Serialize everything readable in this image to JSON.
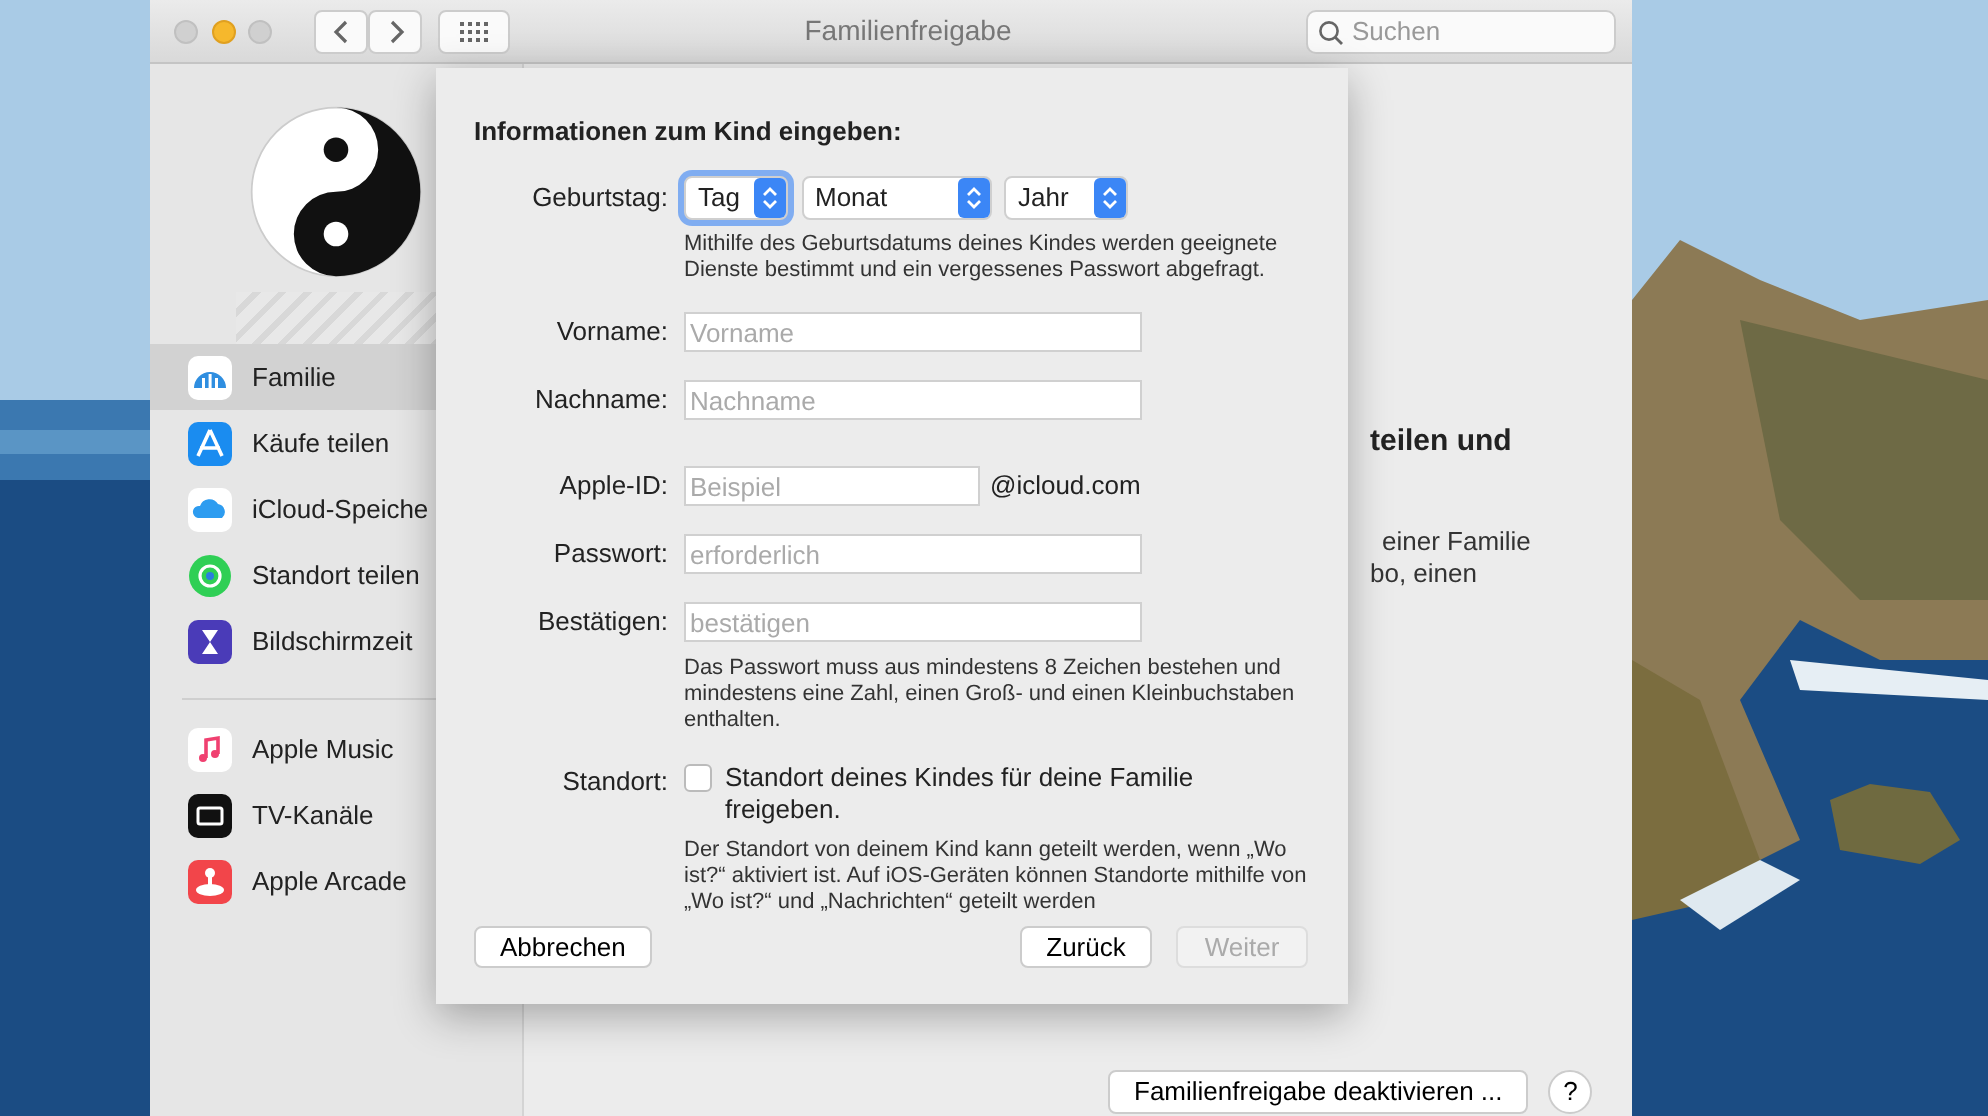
{
  "window": {
    "title": "Familienfreigabe",
    "search": {
      "placeholder": "Suchen"
    }
  },
  "sidebar": {
    "sections": [
      [
        {
          "label": "Familie",
          "selected": true
        },
        {
          "label": "Käufe teilen",
          "selected": false
        },
        {
          "label": "iCloud-Speiche",
          "selected": false
        },
        {
          "label": "Standort teilen",
          "selected": false
        },
        {
          "label": "Bildschirmzeit",
          "selected": false
        }
      ],
      [
        {
          "label": "Apple Music",
          "selected": false
        },
        {
          "label": "TV-Kanäle",
          "selected": false
        },
        {
          "label": "Apple Arcade",
          "selected": false
        }
      ]
    ]
  },
  "main": {
    "heading": "teilen und",
    "text_lines": [
      "einer Familie",
      "bo, einen"
    ],
    "deactivate_button": "Familienfreigabe deaktivieren ...",
    "help_button": "?"
  },
  "dialog": {
    "heading": "Informationen zum Kind eingeben:",
    "birthday": {
      "label": "Geburtstag:",
      "popups": [
        {
          "value": "Tag",
          "focused": true
        },
        {
          "value": "Monat",
          "focused": false
        },
        {
          "value": "Jahr",
          "focused": false
        }
      ]
    },
    "birthday_hint": "Mithilfe des Geburtsdatums deines Kindes werden geeignete Dienste bestimmt und ein vergessenes Passwort abgefragt.",
    "fields": [
      {
        "label": "Vorname:",
        "placeholder": "Vorname"
      },
      {
        "label": "Nachname:",
        "placeholder": "Nachname"
      },
      {
        "label": "Apple-ID:",
        "placeholder": "Beispiel",
        "suffix": "@icloud.com"
      },
      {
        "label": "Passwort:",
        "placeholder": "erforderlich"
      },
      {
        "label": "Bestätigen:",
        "placeholder": "bestätigen"
      }
    ],
    "password_hint": "Das Passwort muss aus mindestens 8 Zeichen bestehen und mindestens eine Zahl, einen Groß- und einen Kleinbuchstaben enthalten.",
    "location": {
      "label": "Standort:",
      "checkbox_label": "Standort deines Kindes für deine Familie freigeben.",
      "checked": false
    },
    "location_hint": "Der Standort von deinem Kind kann geteilt werden, wenn „Wo ist?“ aktiviert ist. Auf iOS-Geräten können Standorte mithilfe von „Wo ist?“ und „Nachrichten“ geteilt werden",
    "buttons": [
      {
        "label": "Abbrechen",
        "disabled": false,
        "kind": "cancel"
      },
      {
        "label": "Zurück",
        "disabled": false,
        "kind": "nav"
      },
      {
        "label": "Weiter",
        "disabled": true,
        "kind": "nav"
      }
    ]
  }
}
